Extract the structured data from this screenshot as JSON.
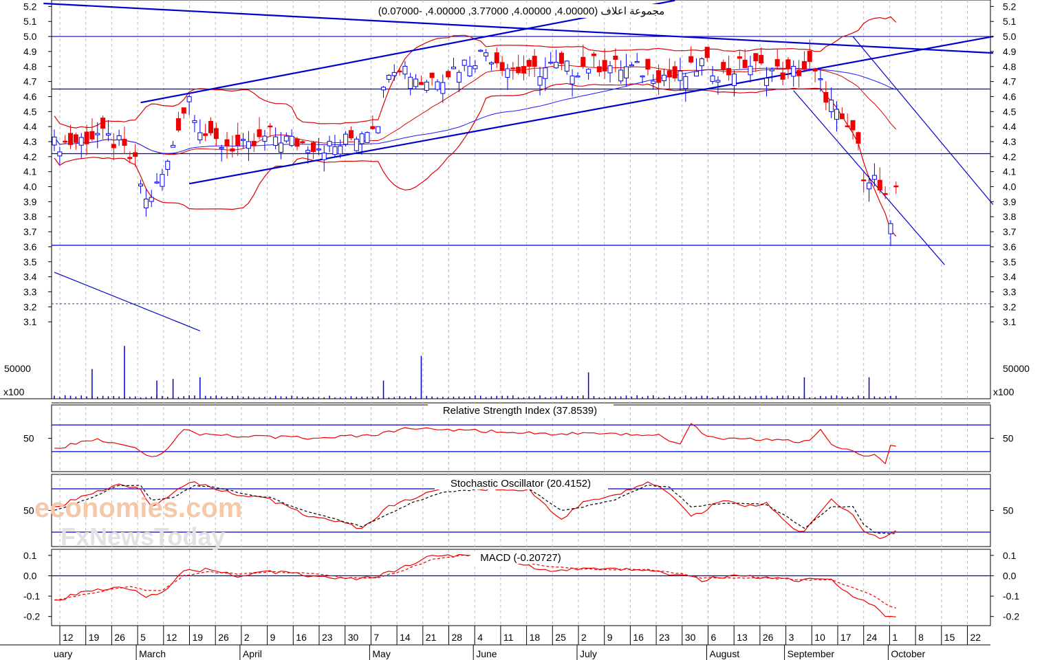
{
  "chart_data": [
    {
      "type": "candlestick",
      "title": "مجموعة اعلاف (4.00000, 4.00000, 3.77000, 4.00000, -0.07000)",
      "ylim": [
        3.0,
        5.22
      ],
      "y_ticks": [
        5.2,
        5.1,
        5.0,
        4.9,
        4.8,
        4.7,
        4.6,
        4.5,
        4.4,
        4.3,
        4.2,
        4.1,
        4.0,
        3.9,
        3.8,
        3.7,
        3.6,
        3.5,
        3.4,
        3.3,
        3.2,
        3.1
      ],
      "x_ticks": [
        "12",
        "19",
        "26",
        "5",
        "12",
        "19",
        "26",
        "2",
        "9",
        "16",
        "23",
        "30",
        "7",
        "14",
        "21",
        "28",
        "4",
        "11",
        "18",
        "25",
        "2",
        "9",
        "16",
        "23",
        "30",
        "6",
        "13",
        "26",
        "3",
        "10",
        "17",
        "24",
        "1",
        "8",
        "15",
        "22"
      ],
      "months": [
        "uary",
        "March",
        "April",
        "May",
        "June",
        "July",
        "August",
        "September",
        "October"
      ],
      "horizontal_levels": [
        5.0,
        4.65,
        4.22,
        3.61
      ],
      "dashed_level": 3.22,
      "grid": true,
      "bullish_color": "#0000ee",
      "bearish_color": "#ee0000",
      "band_color": "#dd0000",
      "line_color": "#0000cc",
      "price_anchors": [
        [
          0,
          4.28
        ],
        [
          4,
          4.3
        ],
        [
          8,
          4.35
        ],
        [
          12,
          4.28
        ],
        [
          15,
          4.15
        ],
        [
          17,
          3.9
        ],
        [
          19,
          4.0
        ],
        [
          21,
          4.15
        ],
        [
          23,
          4.42
        ],
        [
          25,
          4.6
        ],
        [
          27,
          4.4
        ],
        [
          29,
          4.3
        ],
        [
          32,
          4.28
        ],
        [
          36,
          4.25
        ],
        [
          40,
          4.35
        ],
        [
          44,
          4.3
        ],
        [
          48,
          4.28
        ],
        [
          52,
          4.26
        ],
        [
          56,
          4.35
        ],
        [
          60,
          4.45
        ],
        [
          62,
          4.8
        ],
        [
          64,
          4.82
        ],
        [
          68,
          4.7
        ],
        [
          72,
          4.75
        ],
        [
          76,
          4.82
        ],
        [
          80,
          4.9
        ],
        [
          84,
          4.8
        ],
        [
          88,
          4.75
        ],
        [
          92,
          4.8
        ],
        [
          96,
          4.78
        ],
        [
          100,
          4.82
        ],
        [
          104,
          4.8
        ],
        [
          108,
          4.78
        ],
        [
          112,
          4.75
        ],
        [
          116,
          4.72
        ],
        [
          120,
          4.82
        ],
        [
          124,
          4.75
        ],
        [
          128,
          4.82
        ],
        [
          132,
          4.78
        ],
        [
          136,
          4.75
        ],
        [
          140,
          4.8
        ],
        [
          144,
          4.55
        ],
        [
          146,
          4.4
        ],
        [
          148,
          4.38
        ],
        [
          150,
          4.1
        ],
        [
          152,
          4.05
        ],
        [
          154,
          3.9
        ],
        [
          155,
          3.7
        ],
        [
          156,
          4.0
        ]
      ],
      "sessions": 157,
      "volume": {
        "tick": "50000",
        "unit": "x100",
        "spikes": [
          [
            7,
            18
          ],
          [
            13,
            32
          ],
          [
            19,
            11
          ],
          [
            22,
            12
          ],
          [
            27,
            13
          ],
          [
            61,
            11
          ],
          [
            68,
            26
          ],
          [
            99,
            16
          ],
          [
            139,
            13
          ],
          [
            151,
            13
          ]
        ]
      }
    },
    {
      "type": "line",
      "title": "Relative Strength Index (37.8539)",
      "ylim": [
        0,
        100
      ],
      "y_ticks": [
        50
      ],
      "levels": [
        70,
        30
      ],
      "current": 37.8539,
      "color": "#ee0000",
      "anchors": [
        [
          0,
          35
        ],
        [
          8,
          48
        ],
        [
          14,
          40
        ],
        [
          18,
          22
        ],
        [
          20,
          28
        ],
        [
          24,
          62
        ],
        [
          28,
          55
        ],
        [
          40,
          52
        ],
        [
          50,
          50
        ],
        [
          60,
          56
        ],
        [
          66,
          65
        ],
        [
          76,
          62
        ],
        [
          88,
          58
        ],
        [
          100,
          56
        ],
        [
          112,
          55
        ],
        [
          116,
          40
        ],
        [
          118,
          70
        ],
        [
          122,
          50
        ],
        [
          132,
          48
        ],
        [
          140,
          45
        ],
        [
          142,
          62
        ],
        [
          144,
          40
        ],
        [
          148,
          32
        ],
        [
          150,
          22
        ],
        [
          152,
          25
        ],
        [
          154,
          12
        ],
        [
          155,
          38
        ],
        [
          156,
          36
        ]
      ]
    },
    {
      "type": "line",
      "title": "Stochastic Oscillator (20.4152)",
      "ylim": [
        0,
        100
      ],
      "y_ticks": [
        50
      ],
      "levels": [
        80,
        20
      ],
      "current": 20.4152,
      "series": [
        {
          "style": "solid",
          "color": "#ee0000",
          "anchors": [
            [
              0,
              55
            ],
            [
              6,
              70
            ],
            [
              12,
              88
            ],
            [
              16,
              80
            ],
            [
              18,
              55
            ],
            [
              22,
              75
            ],
            [
              26,
              90
            ],
            [
              30,
              78
            ],
            [
              36,
              70
            ],
            [
              40,
              65
            ],
            [
              46,
              45
            ],
            [
              52,
              35
            ],
            [
              57,
              25
            ],
            [
              62,
              55
            ],
            [
              66,
              65
            ],
            [
              72,
              82
            ],
            [
              80,
              80
            ],
            [
              88,
              78
            ],
            [
              94,
              38
            ],
            [
              98,
              60
            ],
            [
              104,
              70
            ],
            [
              110,
              90
            ],
            [
              114,
              75
            ],
            [
              118,
              40
            ],
            [
              124,
              65
            ],
            [
              128,
              55
            ],
            [
              132,
              60
            ],
            [
              136,
              30
            ],
            [
              139,
              20
            ],
            [
              144,
              65
            ],
            [
              148,
              45
            ],
            [
              150,
              20
            ],
            [
              152,
              15
            ],
            [
              153,
              10
            ],
            [
              156,
              20
            ]
          ]
        },
        {
          "style": "dashed",
          "color": "#000000",
          "anchors": [
            [
              0,
              50
            ],
            [
              6,
              65
            ],
            [
              12,
              85
            ],
            [
              16,
              85
            ],
            [
              18,
              65
            ],
            [
              22,
              68
            ],
            [
              26,
              85
            ],
            [
              30,
              82
            ],
            [
              36,
              72
            ],
            [
              40,
              68
            ],
            [
              46,
              50
            ],
            [
              52,
              38
            ],
            [
              57,
              28
            ],
            [
              62,
              45
            ],
            [
              66,
              60
            ],
            [
              72,
              75
            ],
            [
              80,
              80
            ],
            [
              88,
              80
            ],
            [
              94,
              50
            ],
            [
              98,
              55
            ],
            [
              104,
              65
            ],
            [
              110,
              85
            ],
            [
              114,
              82
            ],
            [
              118,
              55
            ],
            [
              124,
              60
            ],
            [
              128,
              60
            ],
            [
              132,
              58
            ],
            [
              136,
              40
            ],
            [
              139,
              25
            ],
            [
              144,
              55
            ],
            [
              148,
              55
            ],
            [
              150,
              30
            ],
            [
              152,
              20
            ],
            [
              153,
              18
            ],
            [
              156,
              18
            ]
          ]
        }
      ]
    },
    {
      "type": "line",
      "title": "MACD (-0.20727)",
      "ylim": [
        -0.245,
        0.13
      ],
      "y_ticks": [
        0.1,
        0.0,
        -0.1,
        -0.2
      ],
      "zero_line": true,
      "current": -0.20727,
      "series": [
        {
          "style": "solid",
          "color": "#ee0000",
          "anchors": [
            [
              0,
              -0.12
            ],
            [
              6,
              -0.08
            ],
            [
              12,
              -0.05
            ],
            [
              14,
              -0.06
            ],
            [
              17,
              -0.1
            ],
            [
              20,
              -0.08
            ],
            [
              24,
              0.02
            ],
            [
              28,
              0.03
            ],
            [
              34,
              0.0
            ],
            [
              40,
              0.02
            ],
            [
              48,
              0.0
            ],
            [
              54,
              -0.02
            ],
            [
              60,
              0.0
            ],
            [
              64,
              0.03
            ],
            [
              70,
              0.1
            ],
            [
              76,
              0.1
            ],
            [
              84,
              0.08
            ],
            [
              90,
              0.03
            ],
            [
              100,
              0.03
            ],
            [
              110,
              0.03
            ],
            [
              116,
              0.0
            ],
            [
              120,
              -0.02
            ],
            [
              126,
              0.0
            ],
            [
              132,
              -0.01
            ],
            [
              138,
              -0.02
            ],
            [
              144,
              -0.02
            ],
            [
              148,
              -0.1
            ],
            [
              152,
              -0.15
            ],
            [
              154,
              -0.2
            ],
            [
              156,
              -0.21
            ]
          ]
        },
        {
          "style": "dashed",
          "color": "#ee0000",
          "anchors": [
            [
              0,
              -0.12
            ],
            [
              6,
              -0.09
            ],
            [
              12,
              -0.06
            ],
            [
              14,
              -0.05
            ],
            [
              17,
              -0.07
            ],
            [
              20,
              -0.07
            ],
            [
              24,
              0.0
            ],
            [
              28,
              0.02
            ],
            [
              34,
              0.01
            ],
            [
              40,
              0.02
            ],
            [
              48,
              0.01
            ],
            [
              54,
              -0.01
            ],
            [
              60,
              -0.01
            ],
            [
              64,
              0.02
            ],
            [
              70,
              0.08
            ],
            [
              76,
              0.1
            ],
            [
              84,
              0.09
            ],
            [
              90,
              0.05
            ],
            [
              100,
              0.03
            ],
            [
              110,
              0.03
            ],
            [
              116,
              0.01
            ],
            [
              120,
              -0.01
            ],
            [
              126,
              -0.01
            ],
            [
              132,
              -0.01
            ],
            [
              138,
              -0.02
            ],
            [
              144,
              -0.02
            ],
            [
              148,
              -0.06
            ],
            [
              152,
              -0.1
            ],
            [
              154,
              -0.14
            ],
            [
              156,
              -0.16
            ]
          ]
        }
      ]
    }
  ],
  "watermark": {
    "brand": "economies.com",
    "sub": "FxNewsToday"
  }
}
